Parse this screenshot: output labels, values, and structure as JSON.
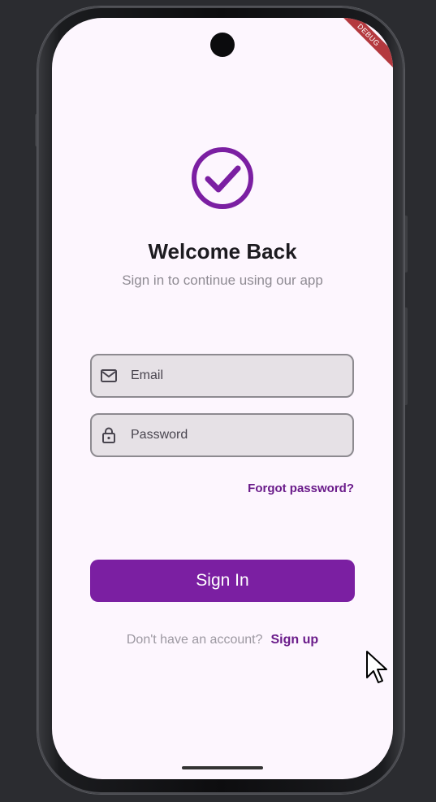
{
  "app": {
    "debug_banner": "DEBUG"
  },
  "header": {
    "title": "Welcome Back",
    "subtitle": "Sign in to continue using our app"
  },
  "form": {
    "email": {
      "placeholder": "Email",
      "value": ""
    },
    "password": {
      "placeholder": "Password",
      "value": ""
    },
    "forgot_label": "Forgot password?",
    "submit_label": "Sign In"
  },
  "footer": {
    "prompt": "Don't have an account?",
    "signup_label": "Sign up"
  },
  "colors": {
    "primary": "#7b1fa2",
    "link": "#6a1b8a",
    "background": "#fdf6fe",
    "field_fill": "#e6e1e6"
  },
  "icons": {
    "logo": "check-circle-icon",
    "email": "mail-icon",
    "password": "lock-icon",
    "cursor": "pointer-cursor-icon"
  }
}
